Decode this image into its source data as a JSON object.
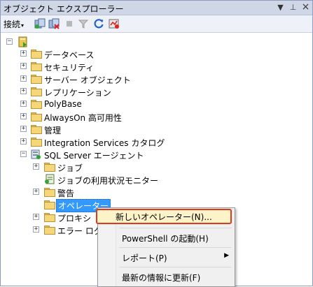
{
  "window": {
    "title": "オブジェクト エクスプローラー",
    "pin_glyph": "⊥",
    "close_glyph": "×",
    "dropdown_glyph": "▼"
  },
  "toolbar": {
    "connect_label": "接続",
    "connect_arrow": "▾"
  },
  "tree": {
    "server_expander": "⊟",
    "items": [
      {
        "label": "データベース",
        "expander": "+"
      },
      {
        "label": "セキュリティ",
        "expander": "+"
      },
      {
        "label": "サーバー オブジェクト",
        "expander": "+"
      },
      {
        "label": "レプリケーション",
        "expander": "+"
      },
      {
        "label": "PolyBase",
        "expander": "+"
      },
      {
        "label": "AlwaysOn 高可用性",
        "expander": "+"
      },
      {
        "label": "管理",
        "expander": "+"
      },
      {
        "label": "Integration Services カタログ",
        "expander": "+"
      },
      {
        "label": "SQL Server エージェント",
        "expander": "−"
      }
    ],
    "agent_children": [
      {
        "label": "ジョブ",
        "expander": "+"
      },
      {
        "label": "ジョブの利用状況モニター",
        "expander": ""
      },
      {
        "label": "警告",
        "expander": "+"
      },
      {
        "label": "オペレーター",
        "expander": ""
      },
      {
        "label": "プロキシ",
        "expander": "+"
      },
      {
        "label": "エラー ログ",
        "expander": "+"
      }
    ]
  },
  "context_menu": {
    "items": [
      {
        "label": "新しいオペレーター(N)..."
      },
      {
        "label": "PowerShell の起動(H)"
      },
      {
        "label": "レポート(P)",
        "submenu_arrow": "▶"
      },
      {
        "label": "最新の情報に更新(F)"
      }
    ]
  },
  "colors": {
    "selection": "#3399ff",
    "highlight_border": "#e03a1b"
  }
}
